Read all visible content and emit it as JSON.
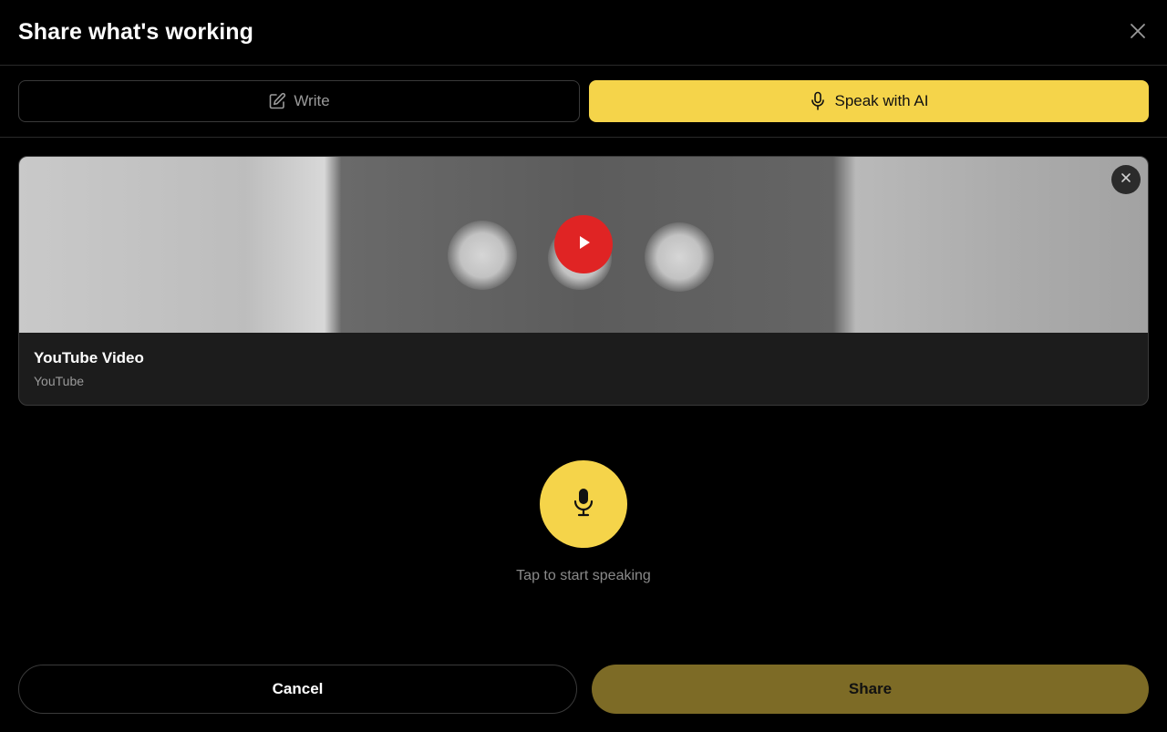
{
  "dialog": {
    "title": "Share what's working"
  },
  "modes": {
    "write_label": "Write",
    "speak_label": "Speak with AI",
    "active": "speak"
  },
  "video": {
    "title": "YouTube Video",
    "source": "YouTube"
  },
  "recorder": {
    "hint": "Tap to start speaking"
  },
  "footer": {
    "cancel_label": "Cancel",
    "share_label": "Share"
  },
  "colors": {
    "accent": "#f5d44a",
    "share_disabled": "#7d6b26",
    "play_red": "#e02424"
  },
  "icons": {
    "close": "close-icon",
    "write": "edit-icon",
    "speak": "microphone-icon",
    "play": "play-icon",
    "remove_video": "close-icon",
    "mic": "microphone-icon"
  }
}
